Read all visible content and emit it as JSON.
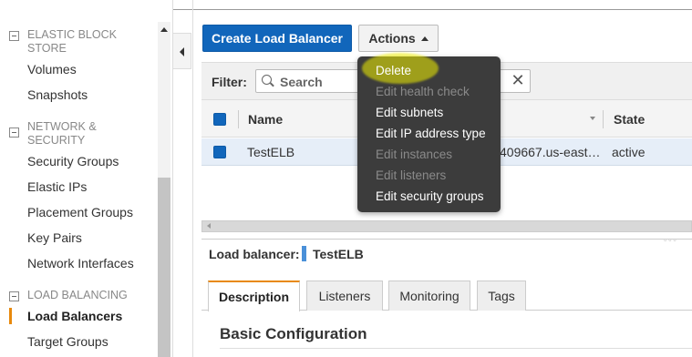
{
  "sidebar": {
    "sections": [
      {
        "label_line1": "ELASTIC BLOCK",
        "label_line2": "STORE"
      },
      {
        "label_line1": "NETWORK &",
        "label_line2": "SECURITY"
      },
      {
        "label_line1": "LOAD BALANCING"
      }
    ],
    "items": [
      {
        "label": "Volumes"
      },
      {
        "label": "Snapshots"
      },
      {
        "label": "Security Groups"
      },
      {
        "label": "Elastic IPs"
      },
      {
        "label": "Placement Groups"
      },
      {
        "label": "Key Pairs"
      },
      {
        "label": "Network Interfaces"
      },
      {
        "label": "Load Balancers"
      },
      {
        "label": "Target Groups"
      }
    ]
  },
  "toolbar": {
    "create_label": "Create Load Balancer",
    "actions_label": "Actions"
  },
  "filter": {
    "label": "Filter:",
    "placeholder": "Search",
    "clear": "✕"
  },
  "table": {
    "columns": [
      "Name",
      "State"
    ],
    "rows": [
      {
        "name": "TestELB",
        "dns": "409667.us-east…",
        "state": "active"
      }
    ]
  },
  "detail": {
    "label": "Load balancer:",
    "name": "TestELB",
    "tabs": [
      "Description",
      "Listeners",
      "Monitoring",
      "Tags"
    ],
    "section_title": "Basic Configuration"
  },
  "menu": {
    "items": [
      {
        "label": "Delete",
        "enabled": true
      },
      {
        "label": "Edit health check",
        "enabled": false
      },
      {
        "label": "Edit subnets",
        "enabled": true
      },
      {
        "label": "Edit IP address type",
        "enabled": true
      },
      {
        "label": "Edit instances",
        "enabled": false
      },
      {
        "label": "Edit listeners",
        "enabled": false
      },
      {
        "label": "Edit security groups",
        "enabled": true
      }
    ]
  },
  "colors": {
    "primary": "#1166bb",
    "accent": "#e8890c",
    "menu_bg": "#3c3c3c",
    "highlight": "#f0f000"
  },
  "icons": [
    "collapse-box-icon",
    "search-icon",
    "clear-icon",
    "caret-up-icon",
    "collapse-left-icon"
  ]
}
